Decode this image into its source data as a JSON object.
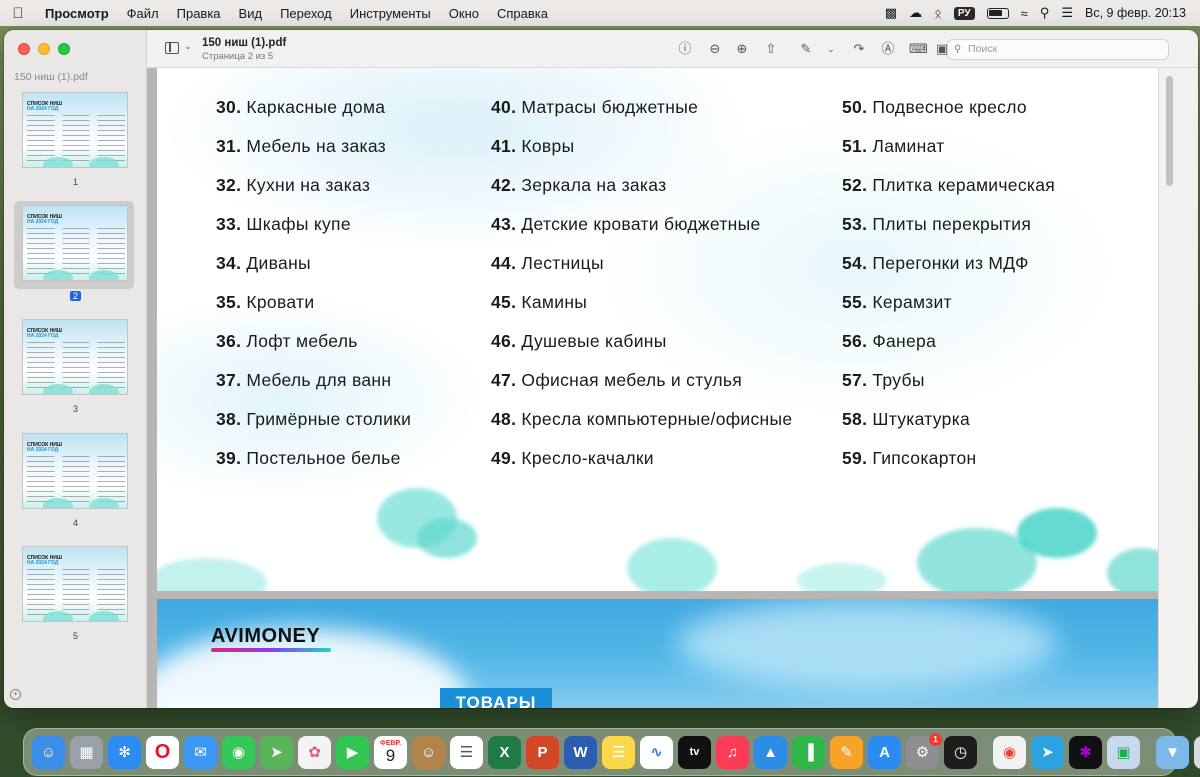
{
  "menubar": {
    "app_name": "Просмотр",
    "menus": [
      "Файл",
      "Правка",
      "Вид",
      "Переход",
      "Инструменты",
      "Окно",
      "Справка"
    ],
    "keyboard_layout": "РУ",
    "datetime": "Вс, 9 февр.  20:13"
  },
  "sidebar": {
    "file_name": "150 ниш (1).pdf",
    "thumbnail_title_line1": "СПИСОК НИШ",
    "thumbnail_title_line2": "НА 2024 ГОД",
    "pages": [
      "1",
      "2",
      "3",
      "4",
      "5"
    ],
    "selected_page": "2"
  },
  "toolbar": {
    "title": "150 ниш (1).pdf",
    "subtitle": "Страница 2 из 5",
    "search_placeholder": "Поиск"
  },
  "document": {
    "columns": [
      [
        {
          "num": "30.",
          "text": "Каркасные дома"
        },
        {
          "num": "31.",
          "text": "Мебель на заказ"
        },
        {
          "num": "32.",
          "text": "Кухни на заказ"
        },
        {
          "num": "33.",
          "text": "Шкафы купе"
        },
        {
          "num": "34.",
          "text": "Диваны"
        },
        {
          "num": "35.",
          "text": "Кровати"
        },
        {
          "num": "36.",
          "text": "Лофт мебель"
        },
        {
          "num": "37.",
          "text": "Мебель для ванн"
        },
        {
          "num": "38.",
          "text": "Гримёрные столики"
        },
        {
          "num": "39.",
          "text": "Постельное белье"
        }
      ],
      [
        {
          "num": "40.",
          "text": "Матрасы бюджетные"
        },
        {
          "num": "41.",
          "text": "Ковры"
        },
        {
          "num": "42.",
          "text": "Зеркала на заказ"
        },
        {
          "num": "43.",
          "text": "Детские кровати бюджетные"
        },
        {
          "num": "44.",
          "text": "Лестницы"
        },
        {
          "num": "45.",
          "text": "Камины"
        },
        {
          "num": "46.",
          "text": "Душевые кабины"
        },
        {
          "num": "47.",
          "text": "Офисная мебель и стулья"
        },
        {
          "num": "48.",
          "text": "Кресла компьютерные/офисные"
        },
        {
          "num": "49.",
          "text": "Кресло-качалки"
        }
      ],
      [
        {
          "num": "50.",
          "text": "Подвесное кресло"
        },
        {
          "num": "51.",
          "text": "Ламинат"
        },
        {
          "num": "52.",
          "text": "Плитка керамическая"
        },
        {
          "num": "53.",
          "text": "Плиты перекрытия"
        },
        {
          "num": "54.",
          "text": "Перегонки из МДФ"
        },
        {
          "num": "55.",
          "text": "Керамзит"
        },
        {
          "num": "56.",
          "text": "Фанера"
        },
        {
          "num": "57.",
          "text": "Трубы"
        },
        {
          "num": "58.",
          "text": "Штукатурка"
        },
        {
          "num": "59.",
          "text": "Гипсокартон"
        }
      ]
    ],
    "next_page_logo": "AVIMONEY",
    "next_page_badge": "ТОВАРЫ"
  },
  "dock": {
    "calendar_month": "ФЕВР.",
    "calendar_day": "9",
    "settings_badge": "1",
    "icons": [
      {
        "name": "finder-icon",
        "color": "#3a8ee8"
      },
      {
        "name": "launchpad-icon",
        "color": "#9aa0a8"
      },
      {
        "name": "safari-icon",
        "color": "#2c8cf0"
      },
      {
        "name": "opera-icon",
        "color": "#ffffff"
      },
      {
        "name": "mail-icon",
        "color": "#3d97f4"
      },
      {
        "name": "messages-icon",
        "color": "#35c759"
      },
      {
        "name": "maps-icon",
        "color": "#5ab55a"
      },
      {
        "name": "photos-icon",
        "color": "#f3f3f3"
      },
      {
        "name": "facetime-icon",
        "color": "#33c553"
      },
      {
        "name": "calendar-icon",
        "color": "#ffffff"
      },
      {
        "name": "contacts-icon",
        "color": "#b0844b"
      },
      {
        "name": "reminders-icon",
        "color": "#ffffff"
      },
      {
        "name": "excel-icon",
        "color": "#1f7a45"
      },
      {
        "name": "powerpoint-icon",
        "color": "#d24726"
      },
      {
        "name": "word-icon",
        "color": "#2b5eaf"
      },
      {
        "name": "notes-icon",
        "color": "#fbd74b"
      },
      {
        "name": "freeform-icon",
        "color": "#ffffff"
      },
      {
        "name": "apple-tv-icon",
        "color": "#111111"
      },
      {
        "name": "music-icon",
        "color": "#fb3c57"
      },
      {
        "name": "keynote-icon",
        "color": "#2d8ce6"
      },
      {
        "name": "numbers-icon",
        "color": "#31b64a"
      },
      {
        "name": "pages-icon",
        "color": "#f7a329"
      },
      {
        "name": "app-store-icon",
        "color": "#2c8bf0"
      },
      {
        "name": "system-settings-icon",
        "color": "#8e8e93"
      },
      {
        "name": "activity-monitor-icon",
        "color": "#1d1d1d"
      },
      {
        "name": "chrome-icon",
        "color": "#f2f2f2"
      },
      {
        "name": "telegram-icon",
        "color": "#2aa3e0"
      },
      {
        "name": "perplexity-icon",
        "color": "#111111"
      },
      {
        "name": "preview-icon",
        "color": "#c8d9ef"
      },
      {
        "name": "downloads-folder-icon",
        "color": "#7cb8e8"
      },
      {
        "name": "trash-icon",
        "color": "#d8dbde"
      }
    ]
  }
}
